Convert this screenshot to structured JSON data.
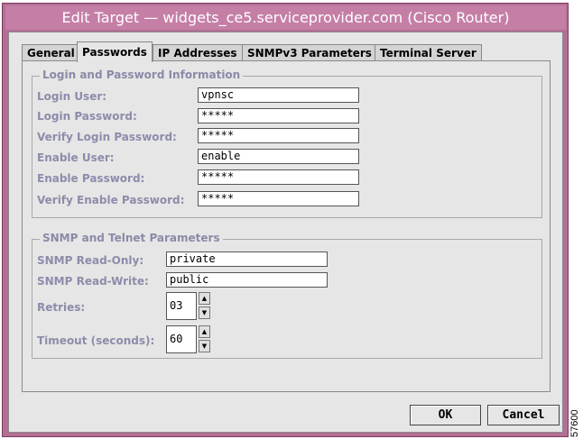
{
  "window": {
    "title": "Edit Target — widgets_ce5.serviceprovider.com (Cisco Router)"
  },
  "tabs": [
    {
      "label": "General"
    },
    {
      "label": "Passwords"
    },
    {
      "label": "IP Addresses"
    },
    {
      "label": "SNMPv3 Parameters"
    },
    {
      "label": "Terminal Server"
    }
  ],
  "active_tab": "Passwords",
  "login_group": {
    "title": "Login and Password Information",
    "fields": [
      {
        "label": "Login User:",
        "value": "vpnsc"
      },
      {
        "label": "Login Password:",
        "value": "*****"
      },
      {
        "label": "Verify Login Password:",
        "value": "*****"
      },
      {
        "label": "Enable User:",
        "value": "enable"
      },
      {
        "label": "Enable Password:",
        "value": "*****"
      },
      {
        "label": "Verify Enable Password:",
        "value": "*****"
      }
    ]
  },
  "snmp_group": {
    "title": "SNMP and Telnet Parameters",
    "read_only": {
      "label": "SNMP Read-Only:",
      "value": "private"
    },
    "read_write": {
      "label": "SNMP Read-Write:",
      "value": "public"
    },
    "retries": {
      "label": "Retries:",
      "value": "03"
    },
    "timeout": {
      "label": "Timeout (seconds):",
      "value": "60"
    }
  },
  "buttons": {
    "ok": "OK",
    "cancel": "Cancel"
  },
  "figure_id": "57600",
  "colors": {
    "title_bar": "#c57fa6",
    "window_frame": "#b46e94",
    "label_text": "#8c8cab"
  }
}
